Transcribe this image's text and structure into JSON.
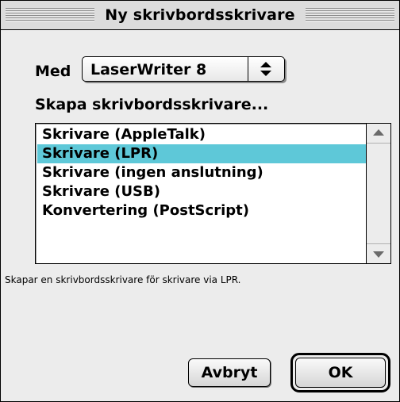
{
  "window": {
    "title": "Ny skrivbordsskrivare"
  },
  "driver": {
    "label": "Med",
    "selected_value": "LaserWriter 8"
  },
  "section_label": "Skapa skrivbordsskrivare...",
  "printer_types": [
    {
      "label": "Skrivare (AppleTalk)",
      "selected": false
    },
    {
      "label": "Skrivare (LPR)",
      "selected": true
    },
    {
      "label": "Skrivare (ingen anslutning)",
      "selected": false
    },
    {
      "label": "Skrivare (USB)",
      "selected": false
    },
    {
      "label": "Konvertering (PostScript)",
      "selected": false
    }
  ],
  "selection_color": "#5ec8d8",
  "description": "Skapar en skrivbordsskrivare för skrivare via LPR.",
  "buttons": {
    "cancel": "Avbryt",
    "ok": "OK"
  },
  "icons": {
    "popup": "up-down-arrows-icon",
    "scroll_up": "scroll-up-arrow-icon",
    "scroll_down": "scroll-down-arrow-icon"
  }
}
